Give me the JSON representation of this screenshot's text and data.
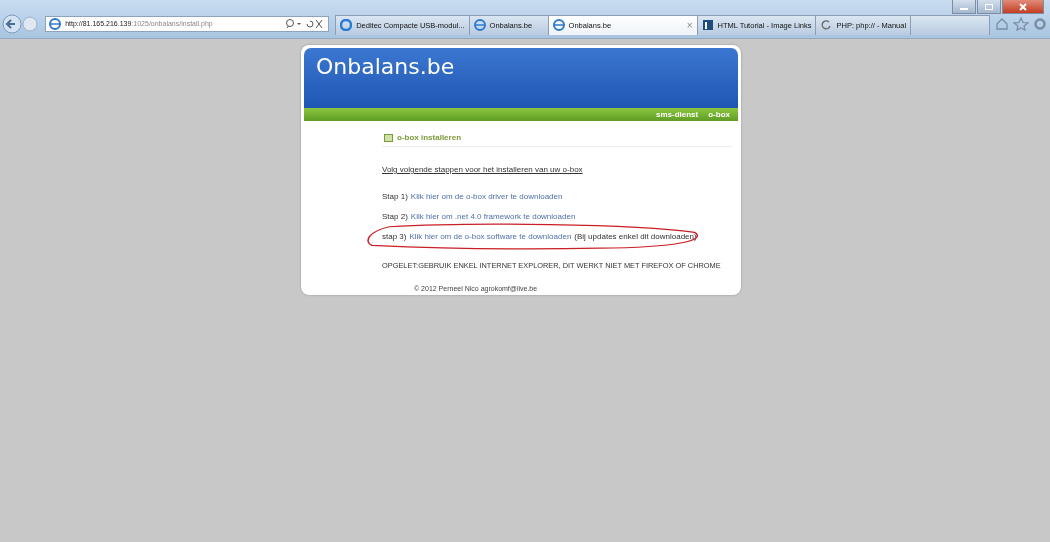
{
  "browser": {
    "address": {
      "host": "http://81.165.216.139",
      "rest": ":1025/onbalans/install.php"
    },
    "tabs": [
      {
        "label": "Deditec Compacte USB-modul...",
        "selected": false,
        "kind": "circle"
      },
      {
        "label": "Onbalans.be",
        "selected": false,
        "kind": "globe"
      },
      {
        "label": "Onbalans.be",
        "selected": true,
        "kind": "globe",
        "close": "×"
      },
      {
        "label": "HTML Tutorial - Image Links",
        "selected": false,
        "kind": "square"
      },
      {
        "label": "PHP: php:// - Manual",
        "selected": false,
        "kind": "loading"
      }
    ]
  },
  "site": {
    "title": "Onbalans.be",
    "nav": [
      "sms-dienst",
      "o-box"
    ],
    "heading": "o-box installeren",
    "intro": "Volg volgende stappen voor het installeren van uw o-box",
    "steps": [
      {
        "prefix": "Stap 1)",
        "link": "Klik hier om de o-box driver te downloaden",
        "highlighted": false
      },
      {
        "prefix": "Stap 2)",
        "link": "Klik hier om  .net 4.0 framework te downloaden",
        "highlighted": false
      },
      {
        "prefix": "stap 3)",
        "link": "Klik hier om de o-box software te downloaden",
        "note": "(Bij updates enkel dit downloaden)",
        "highlighted": true
      }
    ],
    "warning": "OPGELET:GEBRUIK ENKEL INTERNET EXPLORER, DIT WERKT NIET MET FIREFOX OF CHROME",
    "footer": "© 2012 Perneel Nico agrokomf@live.be"
  }
}
